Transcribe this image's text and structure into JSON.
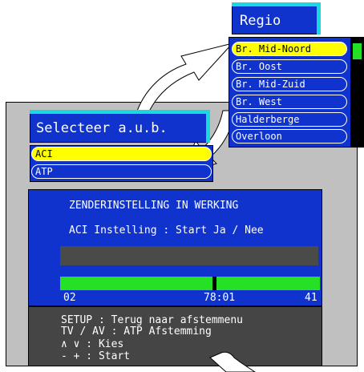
{
  "regio_menu": {
    "title": "Regio",
    "items": [
      "Br. Mid-Noord",
      "Br. Oost",
      "Br. Mid-Zuid",
      "Br. West",
      "Halderberge",
      "Overloon"
    ],
    "selected_index": 0
  },
  "select_menu": {
    "title": "Selecteer a.u.b.",
    "items": [
      "ACI",
      "ATP"
    ],
    "selected_index": 0
  },
  "setup_panel": {
    "heading": "ZENDERINSTELLING IN WERKING",
    "aci_line": "ACI Instelling : Start Ja / Nee",
    "scan_start": "02",
    "scan_freq": "78:01",
    "scan_end": "41"
  },
  "help_panel": {
    "line1": "SETUP : Terug naar afstemmenu",
    "line2": "TV / AV : ATP Afstemming",
    "line3": "∧ ∨ : Kies",
    "line4": "- + : Start"
  },
  "colors": {
    "menu_blue": "#0f33cc",
    "highlight": "#ffff00",
    "title_shadow": "#18d8e0",
    "progress_green": "#25e025",
    "help_gray": "#454545"
  }
}
